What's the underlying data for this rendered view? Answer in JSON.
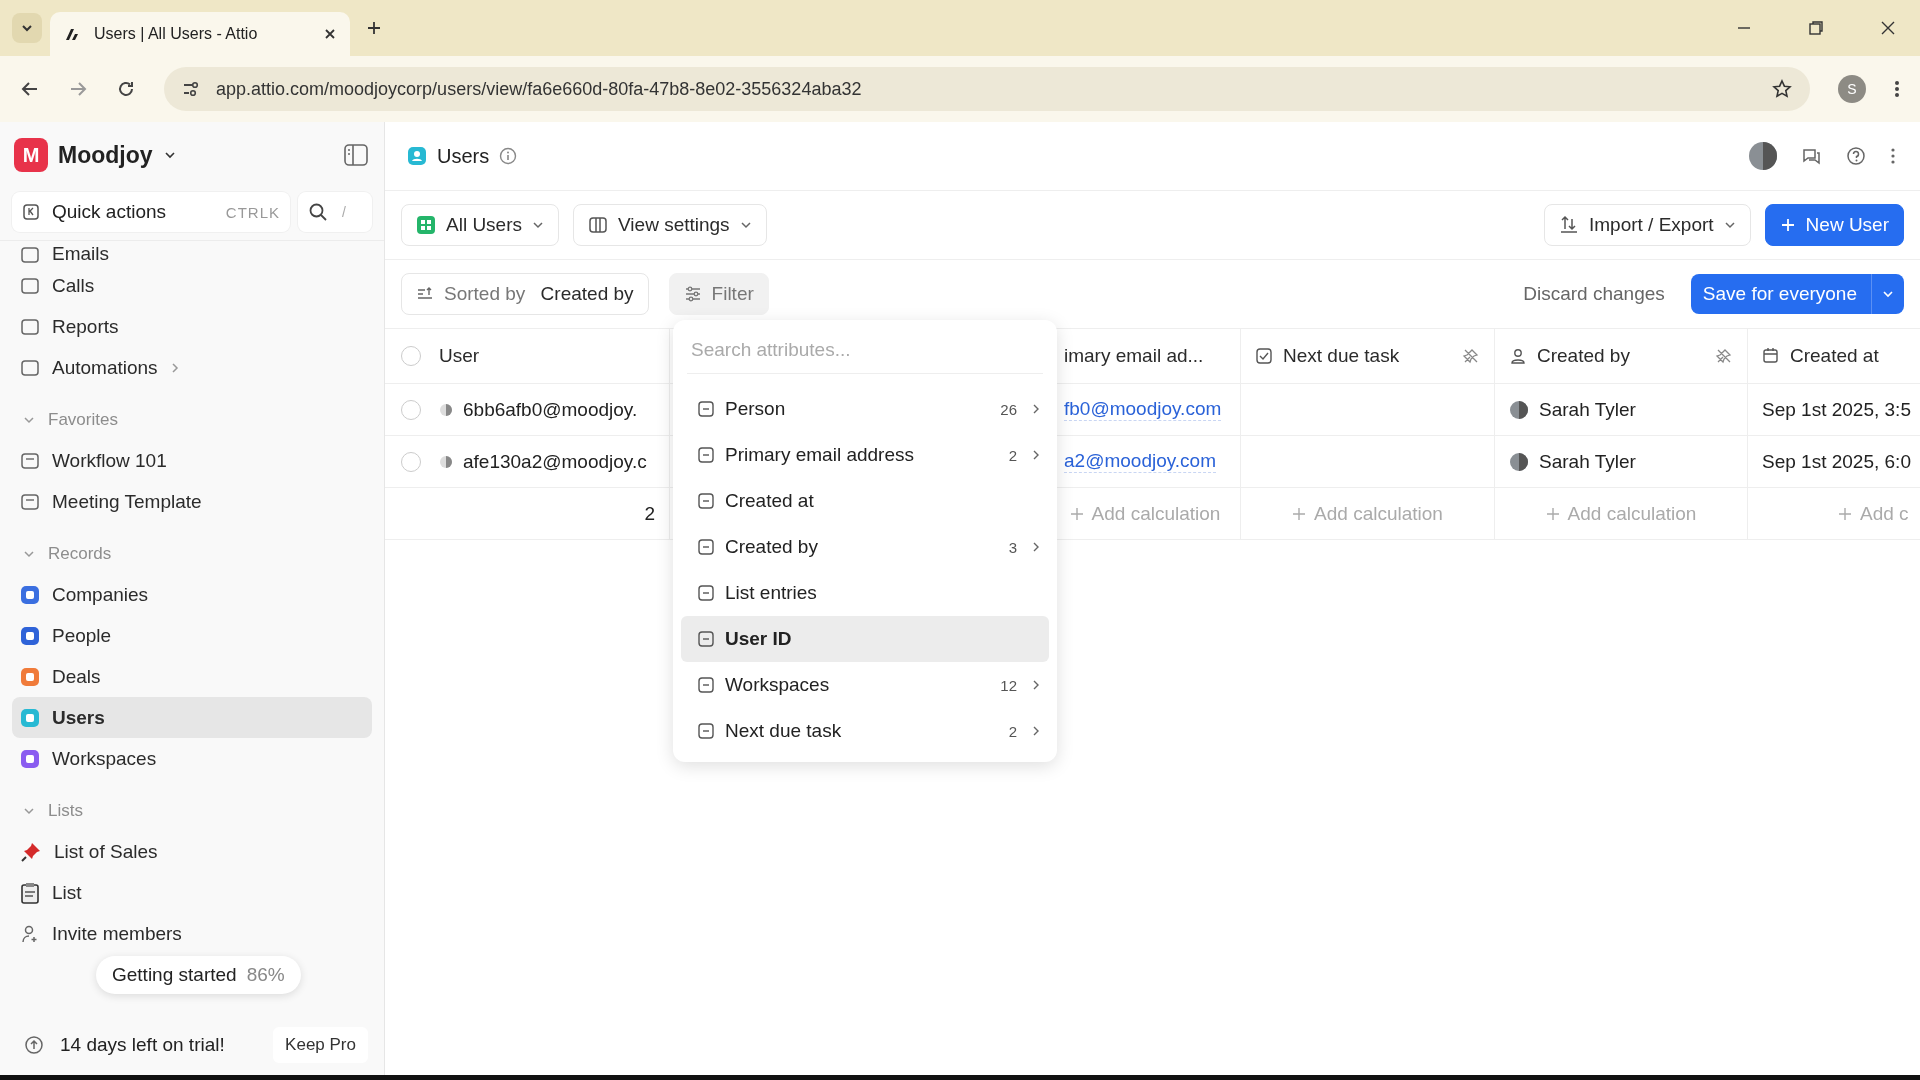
{
  "browser": {
    "tabs": [
      {
        "title": "Users | All Users - Attio",
        "selected": true
      }
    ],
    "url": "app.attio.com/moodjoycorp/users/view/fa6e660d-80fa-47b8-8e02-3556324aba32",
    "profile": "S"
  },
  "sidebar": {
    "workspace": "Moodjoy",
    "workspace_initial": "M",
    "quick_actions": "Quick actions",
    "shortcut": "CTRLK",
    "search_shortcut": "/",
    "nav": [
      {
        "label": "Emails"
      },
      {
        "label": "Calls"
      },
      {
        "label": "Reports"
      },
      {
        "label": "Automations"
      }
    ],
    "sections": [
      {
        "title": "Favorites",
        "expanded": true,
        "items": [
          {
            "label": "Workflow 101",
            "selected": false
          },
          {
            "label": "Meeting Template",
            "selected": false
          }
        ]
      },
      {
        "title": "Records",
        "expanded": true,
        "items": [
          {
            "label": "Companies",
            "color": "#3b6fe0",
            "selected": false
          },
          {
            "label": "People",
            "color": "#2f63d8",
            "selected": false
          },
          {
            "label": "Deals",
            "color": "#f07b3a",
            "selected": false
          },
          {
            "label": "Users",
            "color": "#27b9d3",
            "selected": true
          },
          {
            "label": "Workspaces",
            "color": "#8a5cf0",
            "selected": false
          }
        ]
      },
      {
        "title": "Lists",
        "expanded": true,
        "items": [
          {
            "label": "List of Sales",
            "selected": false
          },
          {
            "label": "List",
            "selected": false
          }
        ]
      }
    ],
    "invite": "Invite members",
    "trial": "14 days left on trial!",
    "keep_pro": "Keep Pro",
    "tooltip": {
      "label": "Getting started",
      "percent": "86%"
    }
  },
  "header": {
    "title": "Users"
  },
  "toolbar": {
    "view": "All Users",
    "view_settings": "View settings",
    "import_export": "Import / Export",
    "new_button": "New User"
  },
  "sortbar": {
    "sorted_label": "Sorted by",
    "sorted_value": "Created by",
    "filter": "Filter",
    "discard": "Discard changes",
    "save": "Save for everyone"
  },
  "table": {
    "select_all_checked": false,
    "columns": [
      {
        "label": "User"
      },
      {
        "label": "imary email ad..."
      },
      {
        "label": "Next due task"
      },
      {
        "label": "Created by"
      },
      {
        "label": "Created at"
      }
    ],
    "rows": [
      {
        "checked": false,
        "user": "6bb6afb0@moodjoy.",
        "email": "fb0@moodjoy.com",
        "created_by": "Sarah Tyler",
        "created_at": "Sep 1st 2025, 3:5"
      },
      {
        "checked": false,
        "user": "afe130a2@moodjoy.c",
        "email": "a2@moodjoy.com",
        "created_by": "Sarah Tyler",
        "created_at": "Sep 1st 2025, 6:0"
      }
    ],
    "calculations": {
      "count": "2",
      "add": [
        "Add calculation",
        "Add calculation",
        "Add calculation",
        "Add c"
      ]
    }
  },
  "dropdown": {
    "placeholder": "Search attributes...",
    "items": [
      {
        "label": "Person",
        "count": "26",
        "highlighted": false
      },
      {
        "label": "Primary email address",
        "count": "2",
        "highlighted": false
      },
      {
        "label": "Created at",
        "highlighted": false
      },
      {
        "label": "Created by",
        "count": "3",
        "highlighted": false
      },
      {
        "label": "List entries",
        "highlighted": false
      },
      {
        "label": "User ID",
        "highlighted": true
      },
      {
        "label": "Workspaces",
        "count": "12",
        "highlighted": false
      },
      {
        "label": "Next due task",
        "count": "2",
        "highlighted": false
      }
    ]
  }
}
